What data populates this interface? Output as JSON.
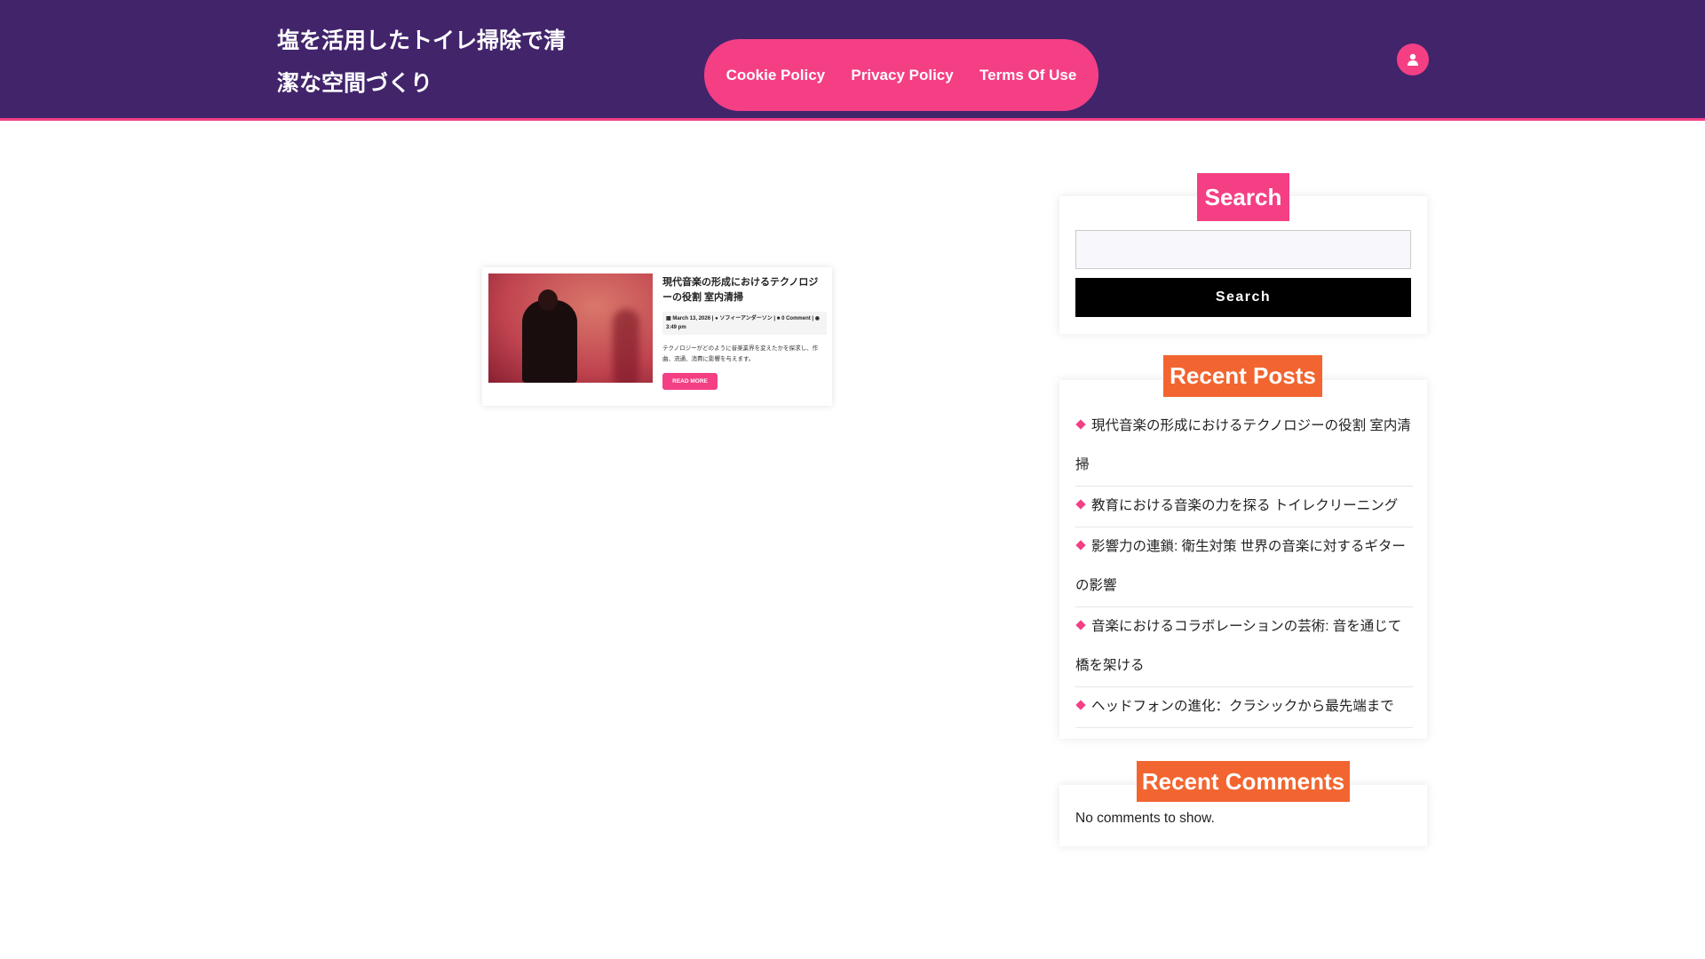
{
  "header": {
    "site_title": "塩を活用したトイレ掃除で清潔な空間づくり",
    "nav": [
      "Cookie Policy",
      "Privacy Policy",
      "Terms Of Use"
    ]
  },
  "post": {
    "title": "現代音楽の形成におけるテクノロジーの役割 室内清掃",
    "date": "March 13, 2026",
    "author": "ソフィーアンダーソン",
    "comments": "0 Comment",
    "time": "3:49 pm",
    "excerpt": "テクノロジーがどのように音楽業界を変えたかを探求し、作曲、流通、消費に影響を与えます。",
    "read_more": "READ MORE"
  },
  "sidebar": {
    "search": {
      "title": "Search",
      "placeholder": "",
      "button": "Search"
    },
    "recent_posts": {
      "title": "Recent Posts",
      "items": [
        "現代音楽の形成におけるテクノロジーの役割 室内清掃",
        "教育における音楽の力を探る トイレクリーニング",
        "影響力の連鎖: 衛生対策 世界の音楽に対するギターの影響",
        "音楽におけるコラボレーションの芸術: 音を通じて橋を架ける",
        "ヘッドフォンの進化：クラシックから最先端まで"
      ]
    },
    "recent_comments": {
      "title": "Recent Comments",
      "empty": "No comments to show."
    }
  },
  "colors": {
    "header": "#42246b",
    "accent": "#f43f85",
    "badge_orange": "#f26530"
  }
}
